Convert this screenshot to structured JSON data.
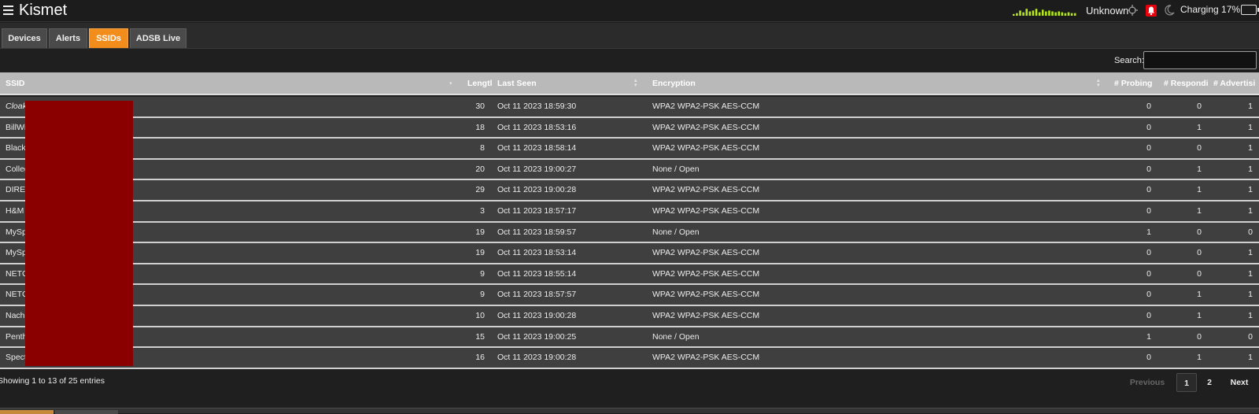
{
  "app": {
    "title": "Kismet",
    "gps_status": "Unknown",
    "battery_status": "Charging 17%"
  },
  "icons": {
    "menu": "hamburger-menu-icon",
    "gps": "crosshair-icon",
    "alert": "bell-icon",
    "theme": "moon-icon",
    "battery": "battery-icon",
    "signal": "signal-activity-bars"
  },
  "colors": {
    "active_tab": "#f28c1b",
    "alert": "#e8000c",
    "signal": "#b5e61d",
    "redaction": "#8a0000"
  },
  "signal_levels": [
    0.2,
    0.3,
    0.6,
    0.4,
    0.8,
    0.5,
    0.6,
    0.8,
    0.4,
    0.7,
    0.5,
    0.6,
    0.5,
    0.4,
    0.5,
    0.4,
    0.3,
    0.4,
    0.3,
    0.3
  ],
  "tabs": [
    {
      "label": "Devices",
      "active": false
    },
    {
      "label": "Alerts",
      "active": false
    },
    {
      "label": "SSIDs",
      "active": true
    },
    {
      "label": "ADSB Live",
      "active": false
    }
  ],
  "search": {
    "label": "Search:",
    "value": ""
  },
  "table": {
    "columns": [
      "SSID",
      "Lengtl",
      "Last Seen",
      "Encryption",
      "# Probing",
      "# Respondi",
      "# Advertisi"
    ],
    "rows": [
      {
        "ssid": "Cloak",
        "ssid_italic": true,
        "length": "30",
        "last_seen": "Oct 11 2023 18:59:30",
        "encryption": "WPA2 WPA2-PSK AES-CCM",
        "probing": "0",
        "responding": "0",
        "advertising": "1"
      },
      {
        "ssid": "BillWi",
        "length": "18",
        "last_seen": "Oct 11 2023 18:53:16",
        "encryption": "WPA2 WPA2-PSK AES-CCM",
        "probing": "0",
        "responding": "1",
        "advertising": "1"
      },
      {
        "ssid": "Black",
        "length": "8",
        "last_seen": "Oct 11 2023 18:58:14",
        "encryption": "WPA2 WPA2-PSK AES-CCM",
        "probing": "0",
        "responding": "0",
        "advertising": "1"
      },
      {
        "ssid": "Colleg",
        "length": "20",
        "last_seen": "Oct 11 2023 19:00:27",
        "encryption": "None / Open",
        "probing": "0",
        "responding": "1",
        "advertising": "1"
      },
      {
        "ssid": "DIRE",
        "length": "29",
        "last_seen": "Oct 11 2023 19:00:28",
        "encryption": "WPA2 WPA2-PSK AES-CCM",
        "probing": "0",
        "responding": "1",
        "advertising": "1"
      },
      {
        "ssid": "H&M",
        "length": "3",
        "last_seen": "Oct 11 2023 18:57:17",
        "encryption": "WPA2 WPA2-PSK AES-CCM",
        "probing": "0",
        "responding": "1",
        "advertising": "1"
      },
      {
        "ssid": "MySp",
        "length": "19",
        "last_seen": "Oct 11 2023 18:59:57",
        "encryption": "None / Open",
        "probing": "1",
        "responding": "0",
        "advertising": "0"
      },
      {
        "ssid": "MySp",
        "length": "19",
        "last_seen": "Oct 11 2023 18:53:14",
        "encryption": "WPA2 WPA2-PSK AES-CCM",
        "probing": "0",
        "responding": "0",
        "advertising": "1"
      },
      {
        "ssid": "NETG",
        "length": "9",
        "last_seen": "Oct 11 2023 18:55:14",
        "encryption": "WPA2 WPA2-PSK AES-CCM",
        "probing": "0",
        "responding": "0",
        "advertising": "1"
      },
      {
        "ssid": "NETG",
        "length": "9",
        "last_seen": "Oct 11 2023 18:57:57",
        "encryption": "WPA2 WPA2-PSK AES-CCM",
        "probing": "0",
        "responding": "1",
        "advertising": "1"
      },
      {
        "ssid": "Nach",
        "length": "10",
        "last_seen": "Oct 11 2023 19:00:28",
        "encryption": "WPA2 WPA2-PSK AES-CCM",
        "probing": "0",
        "responding": "1",
        "advertising": "1"
      },
      {
        "ssid": "Penth",
        "length": "15",
        "last_seen": "Oct 11 2023 19:00:25",
        "encryption": "None / Open",
        "probing": "1",
        "responding": "0",
        "advertising": "0"
      },
      {
        "ssid": "Spect",
        "length": "16",
        "last_seen": "Oct 11 2023 19:00:28",
        "encryption": "WPA2 WPA2-PSK AES-CCM",
        "probing": "0",
        "responding": "1",
        "advertising": "1"
      }
    ]
  },
  "footer": {
    "info": "Showing 1 to 13 of 25 entries",
    "previous": "Previous",
    "pages": [
      "1",
      "2"
    ],
    "current_page": "1",
    "next": "Next"
  }
}
